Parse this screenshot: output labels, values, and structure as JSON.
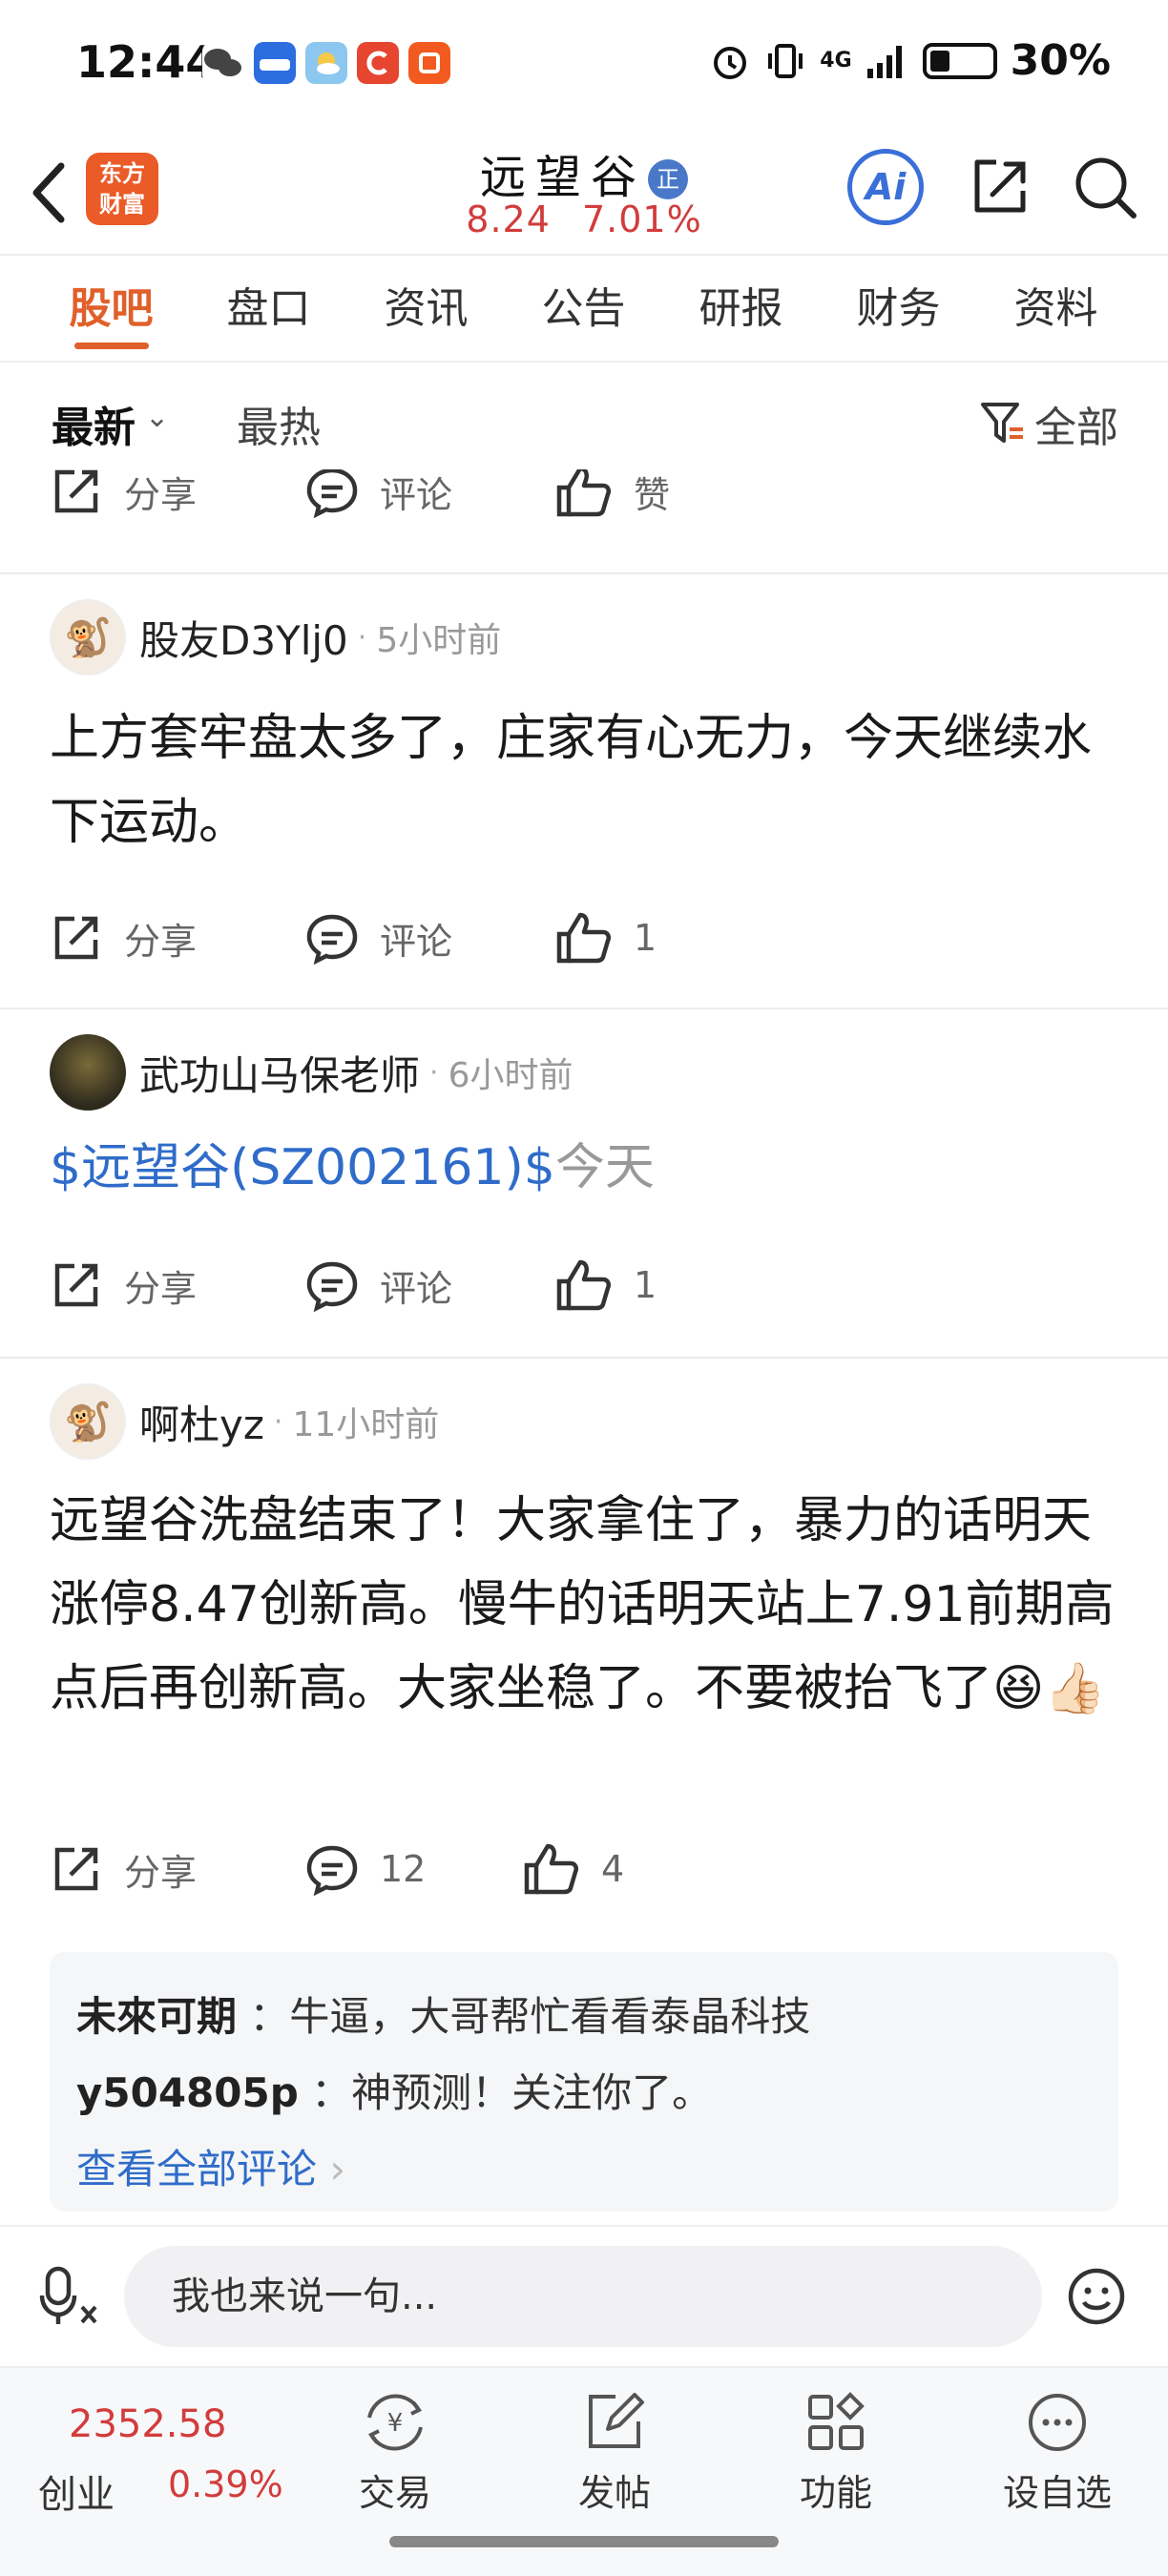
{
  "status_bar": {
    "time": "12:44",
    "network": "4G",
    "battery": "30%",
    "app_icons": [
      "wechat-icon",
      "car-home-icon",
      "weather-icon",
      "c-app-icon",
      "taobao-icon"
    ]
  },
  "header": {
    "app_logo": "东方财富",
    "stock_name": "远望谷",
    "stock_badge": "正",
    "price": "8.24",
    "change_pct": "7.01%",
    "ai_label": "Ai"
  },
  "tabs": [
    "股吧",
    "盘口",
    "资讯",
    "公告",
    "研报",
    "财务",
    "资料"
  ],
  "filter": {
    "latest": "最新",
    "hot": "最热",
    "all": "全部"
  },
  "partial_post": {
    "share": "分享",
    "comment": "评论",
    "like": "赞"
  },
  "posts": [
    {
      "user": "股友D3Ylj0",
      "time": "5小时前",
      "content": "上方套牢盘太多了，庄家有心无力，今天继续水下运动。",
      "share": "分享",
      "comment": "评论",
      "likes": "1"
    },
    {
      "user": "武功山马保老师",
      "time": "6小时前",
      "content_tag": "$远望谷(SZ002161)$",
      "content_rest": "今天",
      "share": "分享",
      "comment": "评论",
      "likes": "1"
    },
    {
      "user": "啊杜yz",
      "time": "11小时前",
      "content": "远望谷洗盘结束了！大家拿住了，暴力的话明天涨停8.47创新高。慢牛的话明天站上7.91前期高点后再创新高。大家坐稳了。不要被抬飞了😆👍🏻",
      "share": "分享",
      "comments": "12",
      "likes": "4",
      "replies": [
        {
          "user": "未來可期",
          "text": "：牛逼，大哥帮忙看看泰晶科技"
        },
        {
          "user": "y504805p",
          "text": "：神预测！关注你了。"
        }
      ],
      "view_all": "查看全部评论"
    }
  ],
  "input_bar": {
    "placeholder": "我也来说一句..."
  },
  "toolbar": {
    "index_value": "2352.58",
    "index_name": "创业",
    "index_pct": "0.39%",
    "items": [
      "交易",
      "发帖",
      "功能",
      "设自选"
    ]
  },
  "colors": {
    "accent": "#e0602b",
    "up_red": "#d23c3c",
    "link_blue": "#2f6cc9"
  }
}
